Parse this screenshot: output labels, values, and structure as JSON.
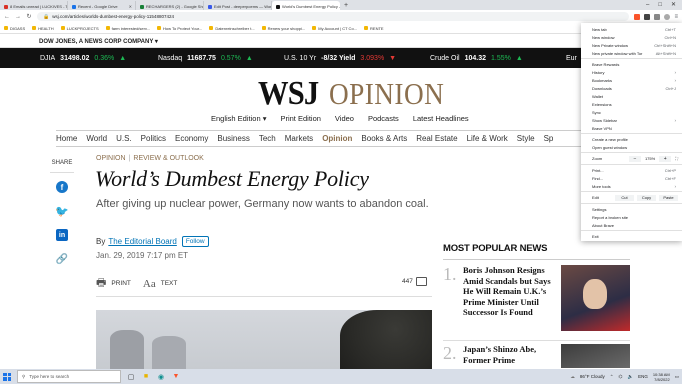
{
  "browser": {
    "tabs": [
      {
        "label": "8 Emails unread | LUCKIVES - Traprox",
        "color": "#d93025",
        "active": false
      },
      {
        "label": "Recent - Google Drive",
        "color": "#1a73e8",
        "active": false
      },
      {
        "label": "RECHARGERS (2) - Google Sheets",
        "color": "#188038",
        "active": false
      },
      {
        "label": "Edit Post - deeperpoems — WordPr...",
        "color": "#3858e9",
        "active": false
      },
      {
        "label": "World's Dumbest Energy Policy - WSJ",
        "color": "#111111",
        "active": true
      }
    ],
    "new_tab": "+",
    "window_controls": [
      "–",
      "□",
      "✕"
    ],
    "url": "wsj.com/articles/worlds-dumbest-energy-policy-11548807424",
    "bookmarks": [
      "DIGASS",
      "HEALTH",
      "LUCKPROJECTS",
      "farm interested/serv...",
      "How To Protect Your...",
      "Datenreinschreiber t...",
      "Renew your shoppi...",
      "My Account | CT Co...",
      "RENTE"
    ]
  },
  "dj_bar": "DOW JONES, A NEWS CORP COMPANY ▾",
  "ticker": [
    {
      "name": "DJIA",
      "value": "31498.02",
      "change": "0.36%",
      "dir": "up"
    },
    {
      "name": "Nasdaq",
      "value": "11687.75",
      "change": "0.57%",
      "dir": "up"
    },
    {
      "name": "U.S. 10 Yr",
      "value": "-8/32 Yield",
      "change": "3.093%",
      "dir": "down"
    },
    {
      "name": "Crude Oil",
      "value": "104.32",
      "change": "1.55%",
      "dir": "up"
    },
    {
      "name": "Eur",
      "value": "",
      "change": "",
      "dir": "up"
    }
  ],
  "masthead": {
    "wsj": "WSJ",
    "opinion": "OPINION"
  },
  "subnav": [
    "English Edition ▾",
    "Print Edition",
    "Video",
    "Podcasts",
    "Latest Headlines"
  ],
  "mainnav": [
    "Home",
    "World",
    "U.S.",
    "Politics",
    "Economy",
    "Business",
    "Tech",
    "Markets",
    "Opinion",
    "Books & Arts",
    "Real Estate",
    "Life & Work",
    "Style",
    "Sp"
  ],
  "mainnav_active": "Opinion",
  "share": {
    "label": "SHARE"
  },
  "article": {
    "kicker_section": "OPINION",
    "kicker_sub": "REVIEW & OUTLOOK",
    "headline": "World’s Dumbest Energy Policy",
    "dek": "After giving up nuclear power, Germany now wants to abandon coal.",
    "by": "By",
    "author": "The Editorial Board",
    "follow": "Follow",
    "date": "Jan. 29, 2019 7:17 pm ET",
    "print": "PRINT",
    "text": "TEXT",
    "comments": "447"
  },
  "most_popular": {
    "title": "MOST POPULAR NEWS",
    "items": [
      {
        "num": "1.",
        "text": "Boris Johnson Resigns Amid Scandals but Says He Will Remain U.K.’s Prime Minister Until Successor Is Found"
      },
      {
        "num": "2.",
        "text": "Japan’s Shinzo Abe, Former Prime"
      }
    ]
  },
  "chrome_menu": {
    "items": [
      {
        "label": "New tab",
        "shortcut": "Ctrl+T"
      },
      {
        "label": "New window",
        "shortcut": "Ctrl+N"
      },
      {
        "label": "New Private window",
        "shortcut": "Ctrl+Shift+N"
      },
      {
        "label": "New private window with Tor",
        "shortcut": "Alt+Shift+N"
      },
      {
        "sep": true
      },
      {
        "label": "Brave Rewards",
        "shortcut": ""
      },
      {
        "label": "History",
        "arrow": true
      },
      {
        "label": "Bookmarks",
        "arrow": true
      },
      {
        "label": "Downloads",
        "shortcut": "Ctrl+J"
      },
      {
        "label": "Wallet",
        "shortcut": ""
      },
      {
        "label": "Extensions",
        "shortcut": ""
      },
      {
        "label": "Sync",
        "shortcut": ""
      },
      {
        "label": "Show Sidebar",
        "arrow": true
      },
      {
        "label": "Brave VPN",
        "shortcut": ""
      },
      {
        "sep": true
      },
      {
        "label": "Create a new profile",
        "shortcut": ""
      },
      {
        "label": "Open guest window",
        "shortcut": ""
      },
      {
        "sep": true
      },
      {
        "zoom": true
      },
      {
        "sep": true
      },
      {
        "label": "Print...",
        "shortcut": "Ctrl+P"
      },
      {
        "label": "Find...",
        "shortcut": "Ctrl+F"
      },
      {
        "label": "More tools",
        "arrow": true
      },
      {
        "sep": true
      },
      {
        "edit": true
      },
      {
        "sep": true
      },
      {
        "label": "Settings",
        "shortcut": ""
      },
      {
        "label": "Report a broken site",
        "shortcut": ""
      },
      {
        "label": "About Brave",
        "shortcut": ""
      },
      {
        "sep": true
      },
      {
        "label": "Exit",
        "shortcut": ""
      }
    ],
    "zoom_label": "Zoom",
    "zoom_minus": "−",
    "zoom_value": "175%",
    "zoom_plus": "+",
    "zoom_full": "⛶",
    "edit_label": "Edit",
    "cut": "Cut",
    "copy": "Copy",
    "paste": "Paste"
  },
  "taskbar": {
    "search_placeholder": "Type here to search",
    "weather": "86°F  Cloudy",
    "lang": "ENG",
    "time": "10:38 AM",
    "date": "7/8/2022"
  },
  "colors": {
    "accent": "#8b6f4e",
    "ticker_bg": "#111111",
    "up": "#1db954",
    "down": "#e53935",
    "link": "#0274b6"
  }
}
